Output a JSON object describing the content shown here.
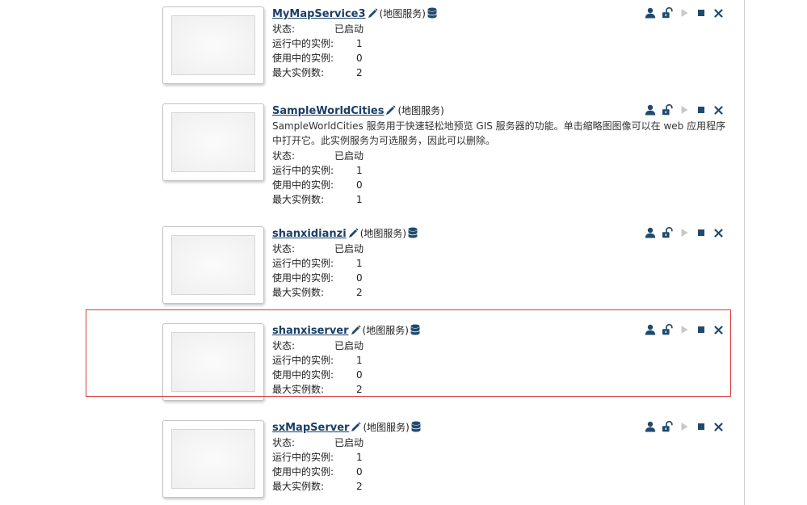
{
  "type_label": "(地图服务)",
  "stat_labels": {
    "status": "状态:",
    "running": "运行中的实例:",
    "in_use": "使用中的实例:",
    "max": "最大实例数:"
  },
  "icons": {
    "edit": "pencil-icon",
    "database": "database-icon",
    "permissions": "user-icon",
    "security": "unlock-icon",
    "start": "play-icon",
    "stop": "stop-icon",
    "delete": "close-icon"
  },
  "colors": {
    "link": "#1a3e66",
    "icon": "#1f4a6e",
    "disabled": "#c8c8c8",
    "selection": "#d9393b"
  },
  "services": [
    {
      "name": "MyMapService3",
      "has_database": true,
      "description": "",
      "status": "已启动",
      "running": "1",
      "in_use": "0",
      "max": "2"
    },
    {
      "name": "SampleWorldCities",
      "has_database": false,
      "description": "SampleWorldCities 服务用于快速轻松地预览 GIS 服务器的功能。单击缩略图图像可以在 web 应用程序中打开它。此实例服务为可选服务，因此可以删除。",
      "status": "已启动",
      "running": "1",
      "in_use": "0",
      "max": "1"
    },
    {
      "name": "shanxidianzi",
      "has_database": true,
      "description": "",
      "status": "已启动",
      "running": "1",
      "in_use": "0",
      "max": "2"
    },
    {
      "name": "shanxiserver",
      "has_database": true,
      "description": "",
      "status": "已启动",
      "running": "1",
      "in_use": "0",
      "max": "2",
      "selected": true
    },
    {
      "name": "sxMapServer",
      "has_database": true,
      "description": "",
      "status": "已启动",
      "running": "1",
      "in_use": "0",
      "max": "2"
    }
  ]
}
